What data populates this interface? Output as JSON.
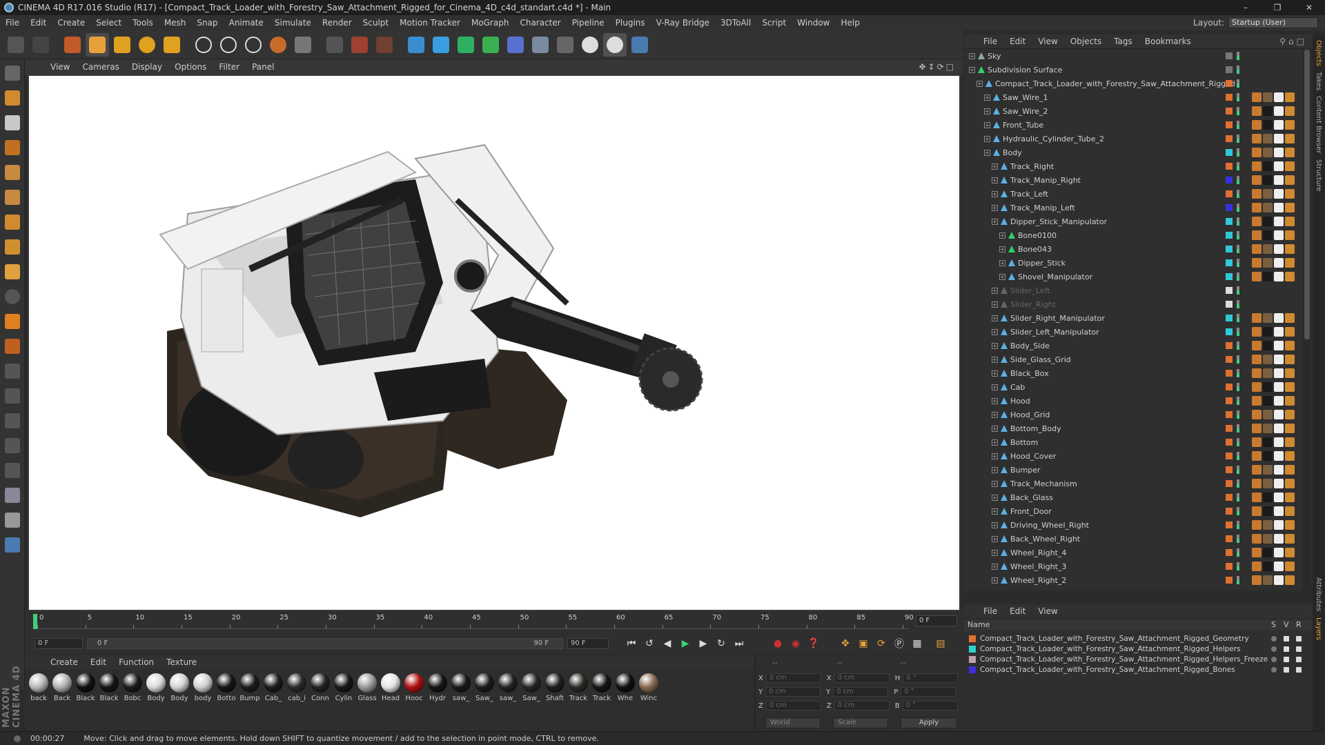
{
  "window": {
    "title": "CINEMA 4D R17.016 Studio (R17) - [Compact_Track_Loader_with_Forestry_Saw_Attachment_Rigged_for_Cinema_4D_c4d_standart.c4d *] - Main"
  },
  "menubar": {
    "items": [
      "File",
      "Edit",
      "Create",
      "Select",
      "Tools",
      "Mesh",
      "Snap",
      "Animate",
      "Simulate",
      "Render",
      "Sculpt",
      "Motion Tracker",
      "MoGraph",
      "Character",
      "Pipeline",
      "Plugins",
      "V-Ray Bridge",
      "3DToAll",
      "Script",
      "Window",
      "Help"
    ],
    "layout_label": "Layout:",
    "layout_value": "Startup (User)"
  },
  "viewport": {
    "menu": [
      "View",
      "Cameras",
      "Display",
      "Options",
      "Filter",
      "Panel"
    ]
  },
  "timeline": {
    "ticks": [
      "0",
      "5",
      "10",
      "15",
      "20",
      "25",
      "30",
      "35",
      "40",
      "45",
      "50",
      "55",
      "60",
      "65",
      "70",
      "75",
      "80",
      "85",
      "90"
    ],
    "current_frame": "0 F",
    "start_field": "0 F",
    "range_start": "0 F",
    "range_end": "90 F",
    "end_field": "90 F"
  },
  "materials": {
    "menu": [
      "Create",
      "Edit",
      "Function",
      "Texture"
    ],
    "items": [
      {
        "label": "back",
        "color": "#b8b8b8"
      },
      {
        "label": "Back",
        "color": "#b0b0b0"
      },
      {
        "label": "Black",
        "color": "#111111"
      },
      {
        "label": "Black",
        "color": "#151515"
      },
      {
        "label": "Bobc",
        "color": "#1a1a1a"
      },
      {
        "label": "Body",
        "color": "#d8d8d8"
      },
      {
        "label": "Body",
        "color": "#d2d2d2"
      },
      {
        "label": "body",
        "color": "#cfcfcf"
      },
      {
        "label": "Botto",
        "color": "#161616"
      },
      {
        "label": "Bump",
        "color": "#1c1c1c"
      },
      {
        "label": "Cab_",
        "color": "#1b1b1b"
      },
      {
        "label": "cab_i",
        "color": "#2a2a2a"
      },
      {
        "label": "Conn",
        "color": "#222222"
      },
      {
        "label": "Cylin",
        "color": "#181818"
      },
      {
        "label": "Glass",
        "color": "#9a9a9a"
      },
      {
        "label": "Head",
        "color": "#e4e4e4"
      },
      {
        "label": "Hooc",
        "color": "#b01010"
      },
      {
        "label": "Hydr",
        "color": "#151515"
      },
      {
        "label": "saw_",
        "color": "#1a1a1a"
      },
      {
        "label": "Saw_",
        "color": "#1d1d1d"
      },
      {
        "label": "saw_",
        "color": "#222222"
      },
      {
        "label": "Saw_",
        "color": "#262626"
      },
      {
        "label": "Shaft",
        "color": "#1e1e1e"
      },
      {
        "label": "Track",
        "color": "#2c2a24"
      },
      {
        "label": "Track",
        "color": "#141414"
      },
      {
        "label": "Whe",
        "color": "#101010"
      },
      {
        "label": "Winc",
        "color": "#8a6a50"
      }
    ]
  },
  "coords": {
    "header_left": "--",
    "header_mid": "--",
    "header_right": "--",
    "rows": [
      {
        "a": "X",
        "av": "0 cm",
        "b": "X",
        "bv": "0 cm",
        "c": "H",
        "cv": "0 °"
      },
      {
        "a": "Y",
        "av": "0 cm",
        "b": "Y",
        "bv": "0 cm",
        "c": "P",
        "cv": "0 °"
      },
      {
        "a": "Z",
        "av": "0 cm",
        "b": "Z",
        "bv": "0 cm",
        "c": "B",
        "cv": "0 °"
      }
    ],
    "world": "World",
    "scale": "Scale",
    "apply": "Apply"
  },
  "objects": {
    "menu": [
      "File",
      "Edit",
      "View",
      "Objects",
      "Tags",
      "Bookmarks"
    ],
    "rows": [
      {
        "label": "Sky",
        "depth": 0,
        "color": "#8aa",
        "dim": false
      },
      {
        "label": "Subdivision Surface",
        "depth": 0,
        "color": "#2fd06a",
        "dim": false
      },
      {
        "label": "Compact_Track_Loader_with_Forestry_Saw_Attachment_Rigged",
        "depth": 1,
        "color": "#5ab0e6",
        "dim": false
      },
      {
        "label": "Saw_Wire_1",
        "depth": 2,
        "color": "#5ab0e6",
        "dim": false
      },
      {
        "label": "Saw_Wire_2",
        "depth": 2,
        "color": "#5ab0e6",
        "dim": false
      },
      {
        "label": "Front_Tube",
        "depth": 2,
        "color": "#5ab0e6",
        "dim": false
      },
      {
        "label": "Hydraulic_Cylinder_Tube_2",
        "depth": 2,
        "color": "#5ab0e6",
        "dim": false
      },
      {
        "label": "Body",
        "depth": 2,
        "color": "#5ab0e6",
        "dim": false
      },
      {
        "label": "Track_Right",
        "depth": 3,
        "color": "#5ab0e6",
        "dim": false
      },
      {
        "label": "Track_Manip_Right",
        "depth": 3,
        "color": "#5ab0e6",
        "dim": false
      },
      {
        "label": "Track_Left",
        "depth": 3,
        "color": "#5ab0e6",
        "dim": false
      },
      {
        "label": "Track_Manip_Left",
        "depth": 3,
        "color": "#5ab0e6",
        "dim": false
      },
      {
        "label": "Dipper_Stick_Manipulator",
        "depth": 3,
        "color": "#5ab0e6",
        "dim": false
      },
      {
        "label": "Bone0100",
        "depth": 4,
        "color": "#2fd06a",
        "dim": false
      },
      {
        "label": "Bone043",
        "depth": 4,
        "color": "#2fd06a",
        "dim": false
      },
      {
        "label": "Dipper_Stick",
        "depth": 4,
        "color": "#5ab0e6",
        "dim": false
      },
      {
        "label": "Shovel_Manipulator",
        "depth": 4,
        "color": "#5ab0e6",
        "dim": false
      },
      {
        "label": "Slider_Left",
        "depth": 3,
        "color": "#666",
        "dim": true
      },
      {
        "label": "Slider_Right",
        "depth": 3,
        "color": "#666",
        "dim": true
      },
      {
        "label": "Slider_Right_Manipulator",
        "depth": 3,
        "color": "#5ab0e6",
        "dim": false
      },
      {
        "label": "Slider_Left_Manipulator",
        "depth": 3,
        "color": "#5ab0e6",
        "dim": false
      },
      {
        "label": "Body_Side",
        "depth": 3,
        "color": "#5ab0e6",
        "dim": false
      },
      {
        "label": "Side_Glass_Grid",
        "depth": 3,
        "color": "#5ab0e6",
        "dim": false
      },
      {
        "label": "Black_Box",
        "depth": 3,
        "color": "#5ab0e6",
        "dim": false
      },
      {
        "label": "Cab",
        "depth": 3,
        "color": "#5ab0e6",
        "dim": false
      },
      {
        "label": "Hood",
        "depth": 3,
        "color": "#5ab0e6",
        "dim": false
      },
      {
        "label": "Hood_Grid",
        "depth": 3,
        "color": "#5ab0e6",
        "dim": false
      },
      {
        "label": "Bottom_Body",
        "depth": 3,
        "color": "#5ab0e6",
        "dim": false
      },
      {
        "label": "Bottom",
        "depth": 3,
        "color": "#5ab0e6",
        "dim": false
      },
      {
        "label": "Hood_Cover",
        "depth": 3,
        "color": "#5ab0e6",
        "dim": false
      },
      {
        "label": "Bumper",
        "depth": 3,
        "color": "#5ab0e6",
        "dim": false
      },
      {
        "label": "Track_Mechanism",
        "depth": 3,
        "color": "#5ab0e6",
        "dim": false
      },
      {
        "label": "Back_Glass",
        "depth": 3,
        "color": "#5ab0e6",
        "dim": false
      },
      {
        "label": "Front_Door",
        "depth": 3,
        "color": "#5ab0e6",
        "dim": false
      },
      {
        "label": "Driving_Wheel_Right",
        "depth": 3,
        "color": "#5ab0e6",
        "dim": false
      },
      {
        "label": "Back_Wheel_Right",
        "depth": 3,
        "color": "#5ab0e6",
        "dim": false
      },
      {
        "label": "Wheel_Right_4",
        "depth": 3,
        "color": "#5ab0e6",
        "dim": false
      },
      {
        "label": "Wheel_Right_3",
        "depth": 3,
        "color": "#5ab0e6",
        "dim": false
      },
      {
        "label": "Wheel_Right_2",
        "depth": 3,
        "color": "#5ab0e6",
        "dim": false
      }
    ]
  },
  "layers": {
    "menu": [
      "File",
      "Edit",
      "View"
    ],
    "col_name": "Name",
    "col_s": "S",
    "col_v": "V",
    "col_r": "R",
    "rows": [
      {
        "label": "Compact_Track_Loader_with_Forestry_Saw_Attachment_Rigged_Geometry",
        "color": "#e07030"
      },
      {
        "label": "Compact_Track_Loader_with_Forestry_Saw_Attachment_Rigged_Helpers",
        "color": "#30d0d0"
      },
      {
        "label": "Compact_Track_Loader_with_Forestry_Saw_Attachment_Rigged_Helpers_Freeze",
        "color": "#c0a0b0"
      },
      {
        "label": "Compact_Track_Loader_with_Forestry_Saw_Attachment_Rigged_Bones",
        "color": "#4030e0"
      }
    ]
  },
  "right_tabs": [
    "Objects",
    "Takes",
    "Content Browser",
    "Structure"
  ],
  "right_tabs_bottom": [
    "Attributes",
    "Layers"
  ],
  "status": {
    "time": "00:00:27",
    "message": "Move: Click and drag to move elements. Hold down SHIFT to quantize movement / add to the selection in point mode, CTRL to remove."
  },
  "brand": "MAXON CINEMA 4D"
}
